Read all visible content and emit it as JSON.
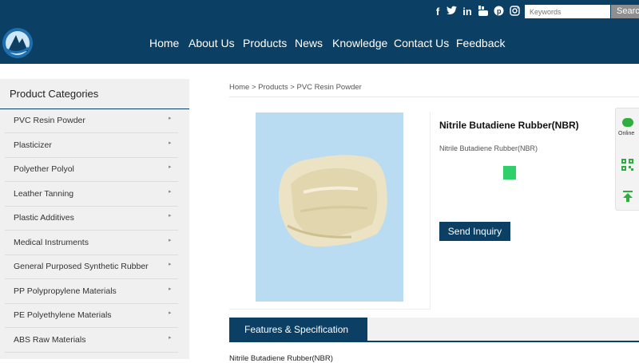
{
  "header": {
    "social": [
      "f",
      "t",
      "in",
      "yt",
      "p",
      "ig"
    ],
    "search": {
      "placeholder": "Keywords",
      "button_label": "Search"
    },
    "nav": [
      "Home",
      "About Us",
      "Products",
      "News",
      "Knowledge",
      "Contact Us",
      "Feedback"
    ]
  },
  "sidebar": {
    "title": "Product Categories",
    "items": [
      "PVC Resin Powder",
      "Plasticizer",
      "Polyether Polyol",
      "Leather Tanning",
      "Plastic Additives",
      "Medical Instruments",
      "General Purposed Synthetic Rubber",
      "PP Polypropylene Materials",
      "PE Polyethylene Materials",
      "ABS Raw Materials"
    ],
    "arrow": "▸"
  },
  "breadcrumb": "Home > Products > PVC Resin Powder",
  "product": {
    "title": "Nitrile Butadiene Rubber(NBR)",
    "subtitle": "Nitrile Butadiene Rubber(NBR)",
    "inquiry_label": "Send Inquiry"
  },
  "float_bar": {
    "online_label": "Online"
  },
  "spec": {
    "tab_label": "Features & Specification",
    "text": "Nitrile Butadiene Rubber(NBR)"
  },
  "colors": {
    "brand": "#0b3f64",
    "accent_green": "#2fcf6a"
  }
}
